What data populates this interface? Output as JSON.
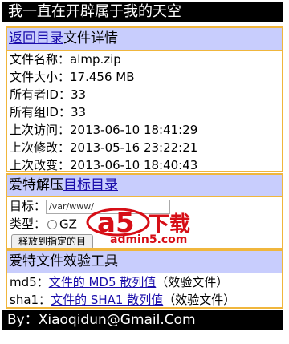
{
  "title": "我一直在开辟属于我的天空",
  "file_panel": {
    "back_link": "返回目录",
    "header_text": "文件详情",
    "rows": [
      "文件名称：almp.zip",
      "文件大小：17.456 MB",
      "所有者ID：33",
      "所有组ID：33",
      "上次访问：2013-06-10 18:41:29",
      "上次修改：2013-05-16 23:22:21",
      "上次改变：2013-06-10 18:40:43"
    ]
  },
  "extract_panel": {
    "header_prefix": "爱特解压",
    "header_link": "目标目录",
    "target_label": "目标：",
    "target_value": "/var/www/",
    "type_label": "类型：",
    "radio_label": "GZ",
    "extract_button": "释放到指定的目"
  },
  "verify_panel": {
    "header": "爱特文件效验工具",
    "md5_label": "md5：",
    "md5_link": "文件的 MD5 散列值",
    "md5_suffix": "（效验文件）",
    "sha1_label": "sha1：",
    "sha1_link": "文件的 SHA1 散列值",
    "sha1_suffix": "（效验文件）"
  },
  "footer": "By：Xiaoqidun@Gmail.Com",
  "watermark": {
    "brand_mark": "a5",
    "big_text": "下载",
    "small_text": "admin5.com"
  },
  "colors": {
    "header_bg": "#c8cdfd",
    "border": "#f0b63c",
    "link": "#1a0dab",
    "watermark_red": "#d60e16"
  }
}
